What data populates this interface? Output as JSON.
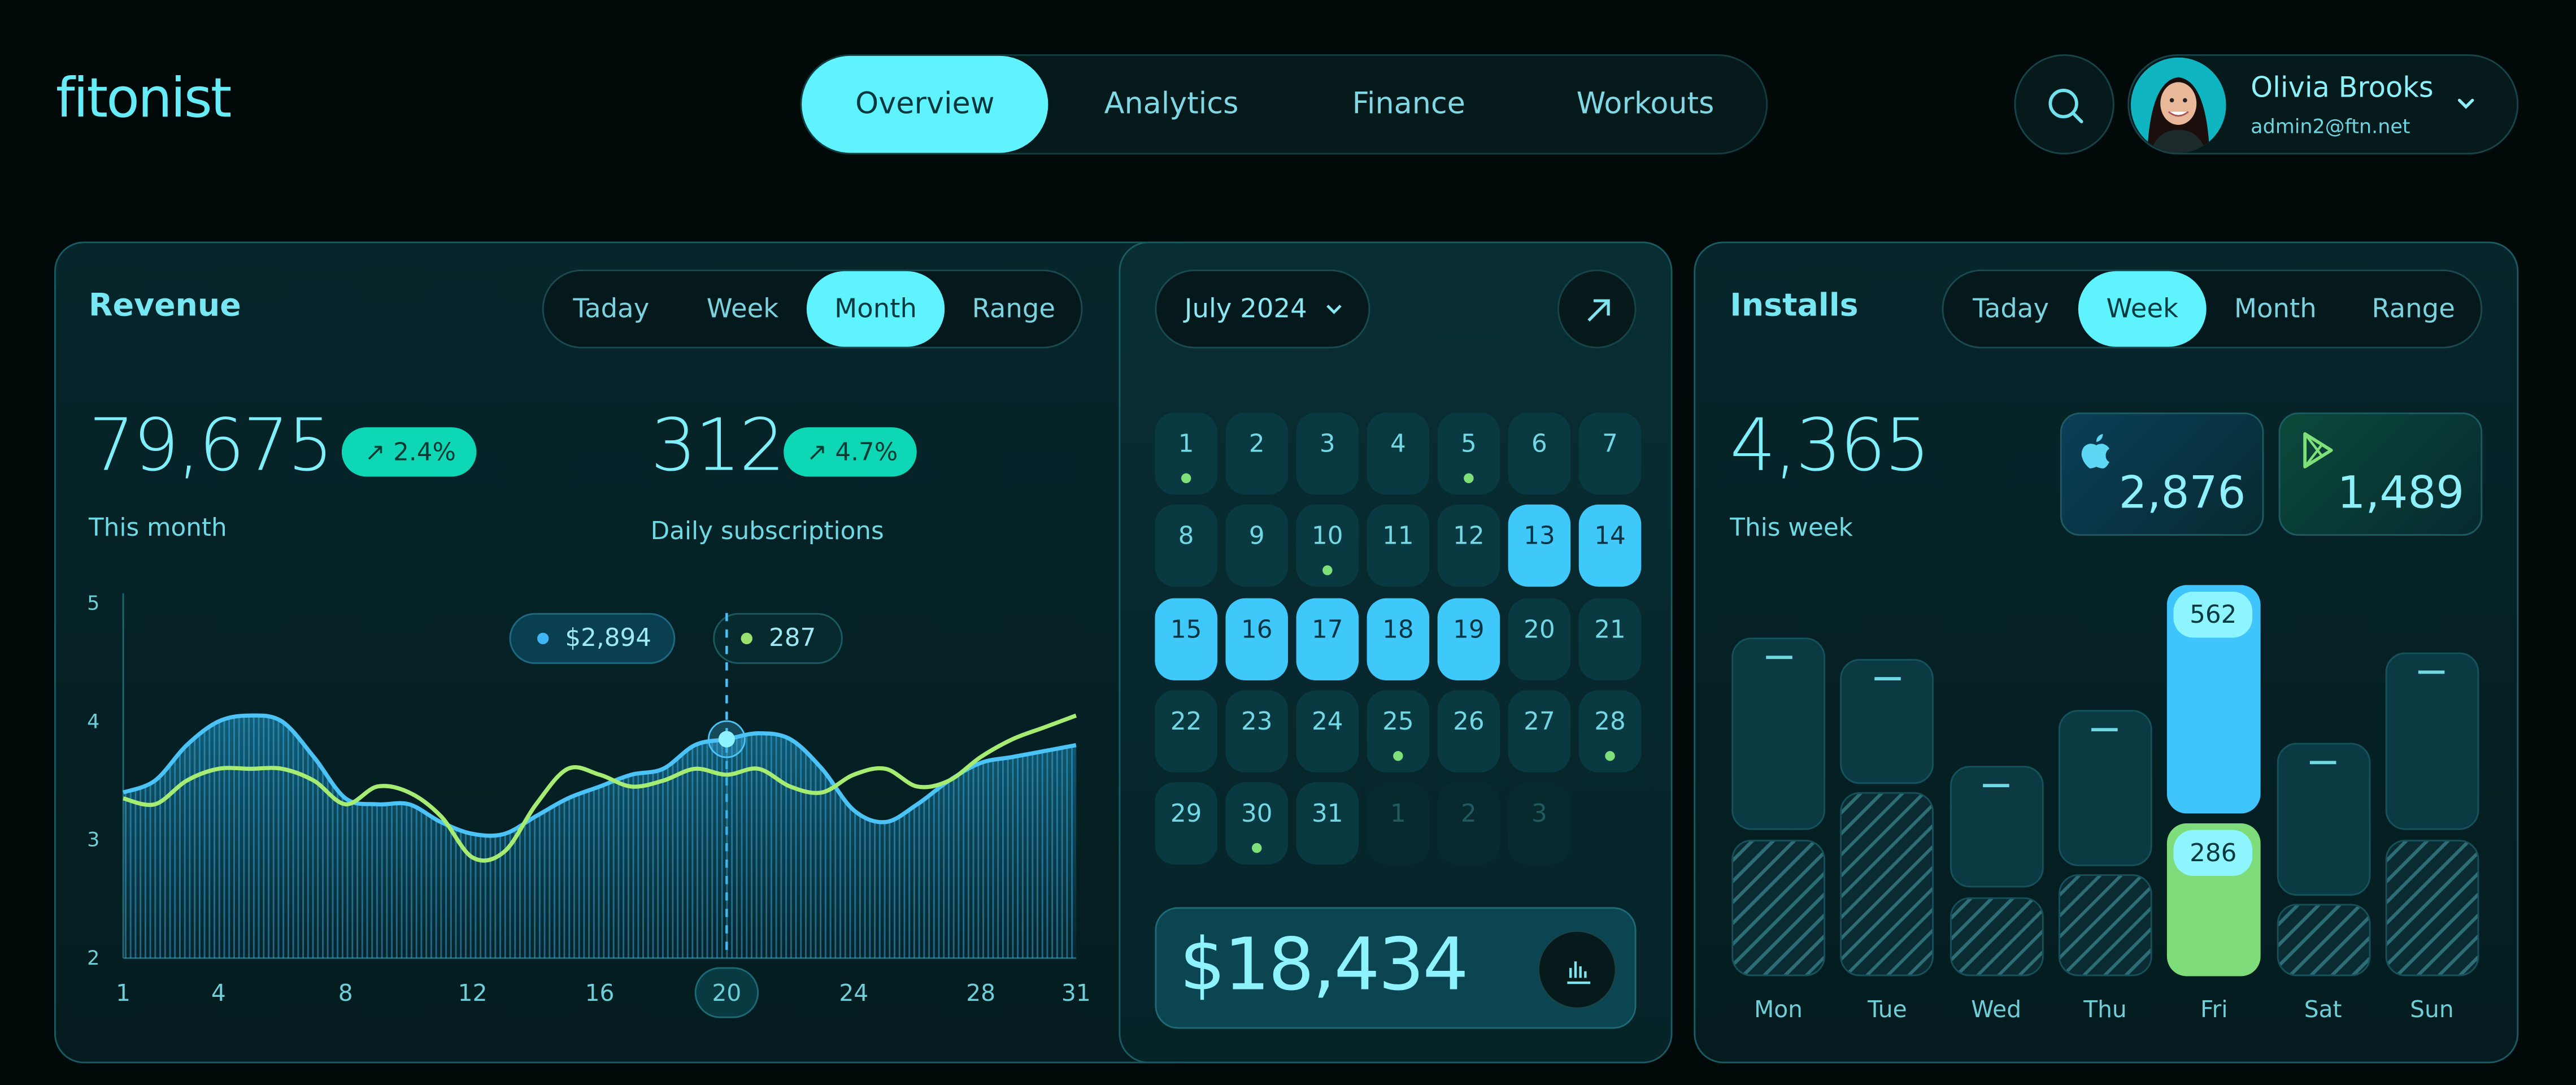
{
  "app": {
    "logo": "fitonist"
  },
  "nav": {
    "tabs": [
      "Overview",
      "Analytics",
      "Finance",
      "Workouts"
    ],
    "active": "Overview"
  },
  "user": {
    "name": "Olivia Brooks",
    "email": "admin2@ftn.net"
  },
  "icons": {
    "search": "search-icon",
    "dropdown": "chevron-down-icon",
    "expand": "arrow-up-right-icon",
    "report": "bar-chart-icon",
    "apple": "apple-icon",
    "play": "play-store-icon"
  },
  "colors": {
    "accent": "#5ff3ff",
    "green": "#0ed7b5",
    "blue_series": "#3fb6f5",
    "green_series": "#9ae06e",
    "background": "#020909"
  },
  "revenue": {
    "title": "Revenue",
    "filters": [
      "Taday",
      "Week",
      "Month",
      "Range"
    ],
    "active_filter": "Month",
    "metric1": {
      "value": "79,675",
      "change": "2.4%",
      "label": "This month"
    },
    "metric2": {
      "value": "312",
      "change": "4.7%",
      "label": "Daily subscriptions"
    },
    "tooltip1": "$2,894",
    "tooltip2": "287"
  },
  "chart_data": {
    "type": "line",
    "x_ticks": [
      1,
      4,
      8,
      12,
      16,
      20,
      24,
      28,
      31
    ],
    "highlight_x": 20,
    "y_ticks": [
      2,
      3,
      4,
      5
    ],
    "ylim": [
      2,
      5
    ],
    "xlim": [
      1,
      31
    ],
    "series": [
      {
        "x": [
          1,
          2,
          3,
          4,
          5,
          6,
          7,
          8,
          9,
          10,
          11,
          12,
          13,
          14,
          15,
          16,
          17,
          18,
          19,
          20,
          21,
          22,
          23,
          24,
          25,
          26,
          27,
          28,
          29,
          30,
          31
        ],
        "values": [
          3.4,
          3.5,
          3.8,
          4.0,
          4.05,
          4.0,
          3.7,
          3.35,
          3.3,
          3.3,
          3.15,
          3.05,
          3.05,
          3.2,
          3.35,
          3.45,
          3.55,
          3.6,
          3.8,
          3.85,
          3.9,
          3.85,
          3.6,
          3.25,
          3.15,
          3.3,
          3.5,
          3.65,
          3.7,
          3.75,
          3.8
        ]
      },
      {
        "x": [
          1,
          2,
          3,
          4,
          5,
          6,
          7,
          8,
          9,
          10,
          11,
          12,
          13,
          14,
          15,
          16,
          17,
          18,
          19,
          20,
          21,
          22,
          23,
          24,
          25,
          26,
          27,
          28,
          29,
          30,
          31
        ],
        "values": [
          3.35,
          3.3,
          3.5,
          3.6,
          3.6,
          3.6,
          3.5,
          3.3,
          3.45,
          3.4,
          3.2,
          2.85,
          2.9,
          3.3,
          3.6,
          3.55,
          3.45,
          3.5,
          3.6,
          3.55,
          3.6,
          3.45,
          3.4,
          3.55,
          3.6,
          3.45,
          3.5,
          3.7,
          3.85,
          3.95,
          4.05
        ]
      }
    ]
  },
  "calendar": {
    "month_label": "July 2024",
    "days": [
      {
        "d": "1",
        "dot": true
      },
      {
        "d": "2"
      },
      {
        "d": "3"
      },
      {
        "d": "4"
      },
      {
        "d": "5",
        "dot": true
      },
      {
        "d": "6"
      },
      {
        "d": "7"
      },
      {
        "d": "8"
      },
      {
        "d": "9"
      },
      {
        "d": "10",
        "dot": true
      },
      {
        "d": "11"
      },
      {
        "d": "12"
      },
      {
        "d": "13",
        "sel": true
      },
      {
        "d": "14",
        "sel": true
      },
      {
        "d": "15",
        "sel": true
      },
      {
        "d": "16",
        "sel": true
      },
      {
        "d": "17",
        "sel": true
      },
      {
        "d": "18",
        "sel": true
      },
      {
        "d": "19",
        "sel": true
      },
      {
        "d": "20"
      },
      {
        "d": "21"
      },
      {
        "d": "22"
      },
      {
        "d": "23"
      },
      {
        "d": "24"
      },
      {
        "d": "25",
        "dot": true
      },
      {
        "d": "26"
      },
      {
        "d": "27"
      },
      {
        "d": "28",
        "dot": true
      },
      {
        "d": "29"
      },
      {
        "d": "30",
        "dot": true
      },
      {
        "d": "31"
      },
      {
        "d": "1",
        "faded": true
      },
      {
        "d": "2",
        "faded": true
      },
      {
        "d": "3",
        "faded": true
      }
    ],
    "total": "$18,434"
  },
  "installs": {
    "title": "Installs",
    "filters": [
      "Taday",
      "Week",
      "Month",
      "Range"
    ],
    "active_filter": "Week",
    "value": "4,365",
    "label": "This week",
    "ios": "2,876",
    "android": "1,489",
    "days": [
      "Mon",
      "Tue",
      "Wed",
      "Thu",
      "Fri",
      "Sat",
      "Sun"
    ],
    "highlight_top": "562",
    "highlight_bottom": "286"
  }
}
